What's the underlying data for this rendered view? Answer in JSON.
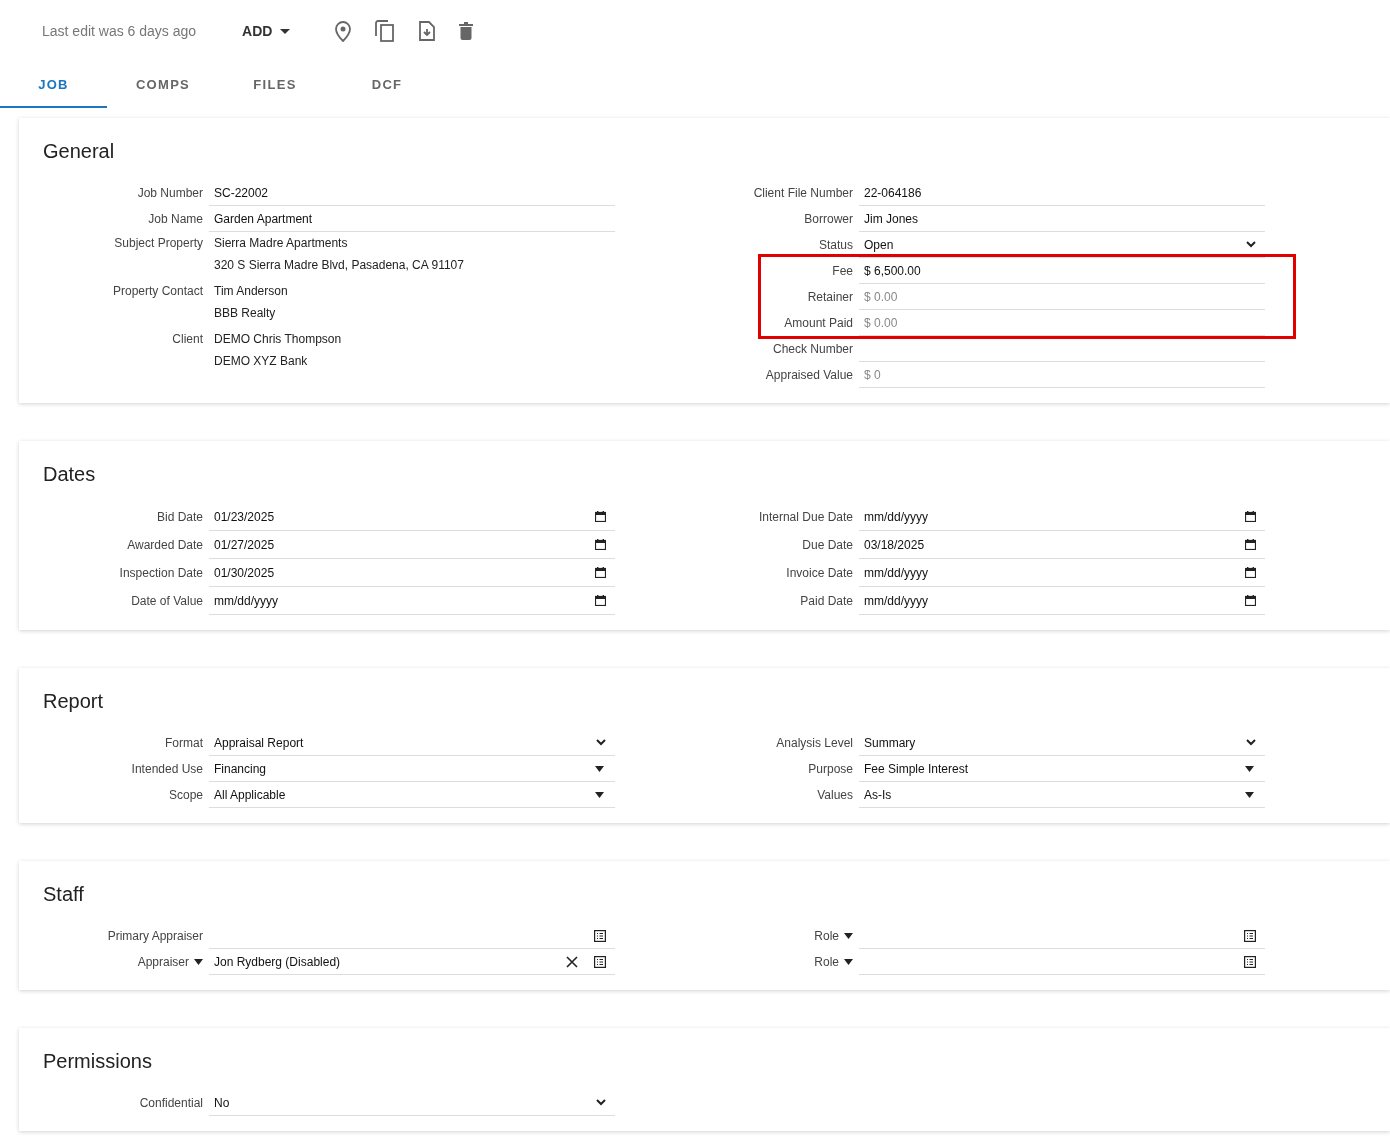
{
  "header": {
    "last_edit": "Last edit was 6 days ago",
    "add_button": "ADD"
  },
  "tabs": [
    {
      "label": "JOB",
      "selected": true
    },
    {
      "label": "COMPS",
      "selected": false
    },
    {
      "label": "FILES",
      "selected": false
    },
    {
      "label": "DCF",
      "selected": false
    }
  ],
  "sections": [
    {
      "title": "General",
      "left": [
        {
          "kind": "text",
          "label": "Job Number",
          "value": "SC-22002"
        },
        {
          "kind": "text",
          "label": "Job Name",
          "value": "Garden Apartment"
        },
        {
          "kind": "lines",
          "label": "Subject Property",
          "lines": [
            "Sierra Madre Apartments",
            "320 S Sierra Madre Blvd, Pasadena, CA 91107"
          ]
        },
        {
          "kind": "lines",
          "label": "Property Contact",
          "lines": [
            "Tim Anderson",
            "BBB Realty"
          ]
        },
        {
          "kind": "lines",
          "label": "Client",
          "lines": [
            "DEMO Chris Thompson",
            "DEMO XYZ Bank"
          ]
        }
      ],
      "right": [
        {
          "kind": "text",
          "label": "Client File Number",
          "value": "22-064186"
        },
        {
          "kind": "text",
          "label": "Borrower",
          "value": "Jim Jones"
        },
        {
          "kind": "select",
          "label": "Status",
          "value": "Open"
        },
        {
          "kind": "highlight",
          "fields": [
            {
              "kind": "text",
              "label": "Fee",
              "value": "$ 6,500.00"
            },
            {
              "kind": "text",
              "label": "Retainer",
              "placeholder": "$ 0.00"
            },
            {
              "kind": "text",
              "label": "Amount Paid",
              "placeholder": "$ 0.00"
            }
          ]
        },
        {
          "kind": "text",
          "label": "Check Number"
        },
        {
          "kind": "text",
          "label": "Appraised Value",
          "placeholder": "$ 0"
        }
      ]
    },
    {
      "title": "Dates",
      "left": [
        {
          "kind": "date",
          "label": "Bid Date",
          "value": "01/23/2025"
        },
        {
          "kind": "date",
          "label": "Awarded Date",
          "value": "01/27/2025"
        },
        {
          "kind": "date",
          "label": "Inspection Date",
          "value": "01/30/2025"
        },
        {
          "kind": "date",
          "label": "Date of Value",
          "value": "mm/dd/yyyy"
        }
      ],
      "right": [
        {
          "kind": "date",
          "label": "Internal Due Date",
          "value": "mm/dd/yyyy"
        },
        {
          "kind": "date",
          "label": "Due Date",
          "value": "03/18/2025"
        },
        {
          "kind": "date",
          "label": "Invoice Date",
          "value": "mm/dd/yyyy"
        },
        {
          "kind": "date",
          "label": "Paid Date",
          "value": "mm/dd/yyyy"
        }
      ]
    },
    {
      "title": "Report",
      "left": [
        {
          "kind": "select",
          "label": "Format",
          "value": "Appraisal Report"
        },
        {
          "kind": "dropdown",
          "label": "Intended Use",
          "value": "Financing"
        },
        {
          "kind": "dropdown",
          "label": "Scope",
          "value": "All Applicable"
        }
      ],
      "right": [
        {
          "kind": "select",
          "label": "Analysis Level",
          "value": "Summary"
        },
        {
          "kind": "dropdown",
          "label": "Purpose",
          "value": "Fee Simple Interest"
        },
        {
          "kind": "dropdown",
          "label": "Values",
          "value": "As-Is"
        }
      ]
    },
    {
      "title": "Staff",
      "left": [
        {
          "kind": "lookup",
          "label": "Primary Appraiser",
          "label_menu": false,
          "clearable": false
        },
        {
          "kind": "lookup",
          "label": "Appraiser",
          "label_menu": true,
          "value": "Jon Rydberg (Disabled)",
          "clearable": true
        }
      ],
      "right": [
        {
          "kind": "lookup",
          "label": "Role",
          "label_menu": true,
          "clearable": false
        },
        {
          "kind": "lookup",
          "label": "Role",
          "label_menu": true,
          "clearable": false
        }
      ]
    },
    {
      "title": "Permissions",
      "left": [
        {
          "kind": "select",
          "label": "Confidential",
          "value": "No"
        }
      ]
    }
  ]
}
